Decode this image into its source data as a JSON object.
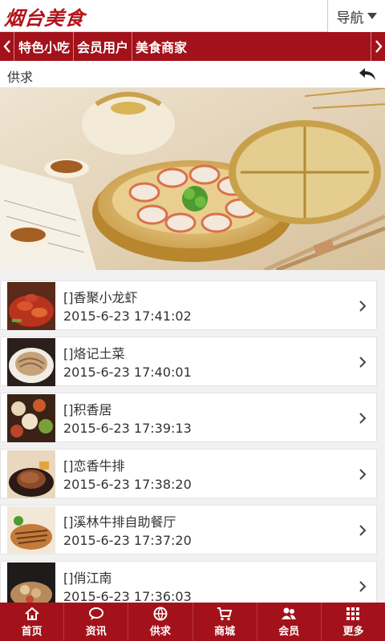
{
  "header": {
    "logo_text": "烟台美食",
    "nav_label": "导航"
  },
  "category_bar": {
    "items": [
      "特色小吃",
      "会员用户",
      "美食商家"
    ]
  },
  "section": {
    "title": "供求"
  },
  "banner": {
    "slide_count": 3,
    "active_slide": 1
  },
  "list": {
    "items": [
      {
        "title": "[]香聚小龙虾",
        "date": "2015-6-23 17:41:02"
      },
      {
        "title": "[]烙记土菜",
        "date": "2015-6-23 17:40:01"
      },
      {
        "title": "[]积香居",
        "date": "2015-6-23 17:39:13"
      },
      {
        "title": "[]恋香牛排",
        "date": "2015-6-23 17:38:20"
      },
      {
        "title": "[]溪林牛排自助餐厅",
        "date": "2015-6-23 17:37:20"
      },
      {
        "title": "[]俏江南",
        "date": "2015-6-23 17:36:03"
      }
    ]
  },
  "bottom_nav": {
    "tabs": [
      {
        "label": "首页",
        "icon": "home-icon"
      },
      {
        "label": "资讯",
        "icon": "chat-bubble-icon"
      },
      {
        "label": "供求",
        "icon": "globe-icon"
      },
      {
        "label": "商城",
        "icon": "cart-icon"
      },
      {
        "label": "会员",
        "icon": "users-icon"
      },
      {
        "label": "更多",
        "icon": "grid-icon"
      }
    ]
  },
  "colors": {
    "brand_red": "#a3121a",
    "logo_red": "#b3121a"
  }
}
